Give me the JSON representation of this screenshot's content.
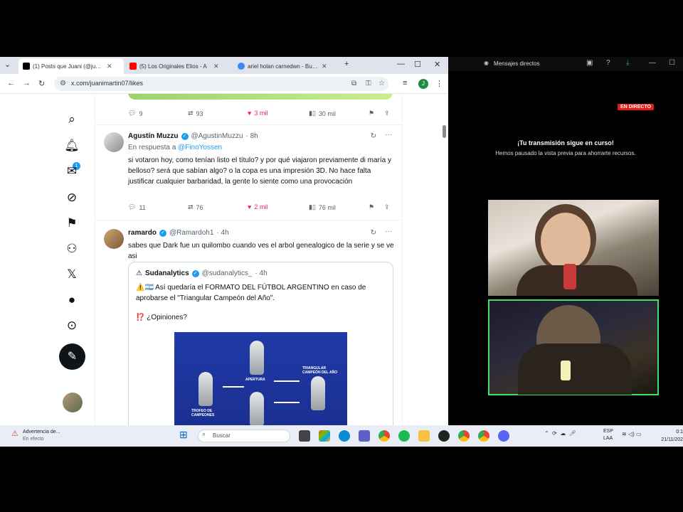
{
  "browser": {
    "tabs": [
      {
        "label": "(1) Posts que Juani (@juanimar",
        "favicon_color": "#000000",
        "active": true
      },
      {
        "label": "(5) Los Originales Elios - A",
        "favicon_color": "#ff0000",
        "active": false
      },
      {
        "label": "ariel holan carnedwn - Buscar",
        "favicon_color": "#4285f4",
        "active": false
      }
    ],
    "url": "x.com/juanimartin07/likes",
    "profile_initial": "J"
  },
  "timeline": {
    "prev_post_actions": {
      "replies": "9",
      "reposts": "93",
      "likes": "3 mil",
      "views": "30 mil"
    },
    "tweets": [
      {
        "name": "Agustín Muzzu",
        "handle": "@AgustinMuzzu",
        "time": "· 8h",
        "reply_to_prefix": "En respuesta a",
        "reply_to_handle": "@FinoYossen",
        "text": "si votaron hoy, como tenían listo el título? y por qué viajaron previamente di maría y belloso? será que sabían algo? o la copa es una impresión 3D. No hace falta justificar cualquier barbaridad, la gente lo siente como una provocación",
        "actions": {
          "replies": "11",
          "reposts": "76",
          "likes": "2 mil",
          "views": "76 mil"
        }
      },
      {
        "name": "ramardo",
        "handle": "@Ramardoh1",
        "time": "· 4h",
        "text": "sabes que Dark fue un quilombo cuando ves el arbol genealogico de la serie y se ve asi"
      }
    ],
    "quote": {
      "name": "Sudanalytics",
      "handle": "@sudanalytics_",
      "time": "· 4h",
      "text": "⚠️🇦🇷 Así quedaría el FORMATO DEL FÚTBOL ARGENTINO en caso de aprobarse el \"Triangular Campeón del Año\".",
      "question": "⁉️ ¿Opiniones?",
      "image_labels": {
        "apertura": "APERTURA",
        "triangular": "TRIANGULAR CAMPEÓN DEL AÑO",
        "trofeo": "TROFEO DE CAMPEONES"
      }
    }
  },
  "stream": {
    "title": "Mensajes directos",
    "live_badge": "EN DIRECTO",
    "message_title": "¡Tu transmisión sigue en curso!",
    "message_body": "Hemos pausado la vista previa para ahorrarte recursos."
  },
  "taskbar": {
    "warning_title": "Advertencia de...",
    "warning_sub": "En efecto",
    "search_placeholder": "Buscar",
    "lang_top": "ESP",
    "lang_bottom": "LAA",
    "time": "0:1",
    "date": "21/11/202"
  },
  "colors": {
    "x_blue": "#1d9bf0",
    "like_pink": "#f91880",
    "live_red": "#e91916",
    "cam_border": "#41e06a"
  }
}
